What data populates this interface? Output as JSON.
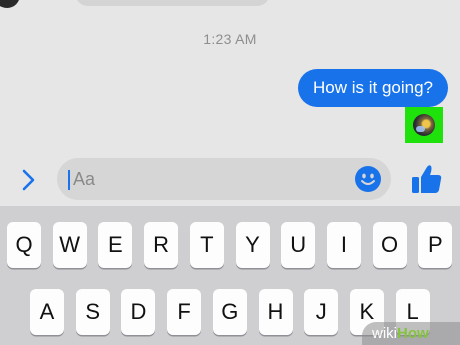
{
  "chat": {
    "timestamp": "1:23 AM",
    "outgoing_message": "How is it going?"
  },
  "composer": {
    "placeholder": "Aa"
  },
  "keyboard": {
    "row1": [
      "Q",
      "W",
      "E",
      "R",
      "T",
      "Y",
      "U",
      "I",
      "O",
      "P"
    ],
    "row2": [
      "A",
      "S",
      "D",
      "F",
      "G",
      "H",
      "J",
      "K",
      "L"
    ]
  },
  "watermark": {
    "prefix": "wiki",
    "suffix": "How"
  },
  "colors": {
    "messenger_blue": "#1873eb",
    "highlight_green": "#1fe10c"
  },
  "icons": {
    "expand": "chevron-right-icon",
    "emoji": "smiley-icon",
    "like": "thumbs-up-icon"
  }
}
